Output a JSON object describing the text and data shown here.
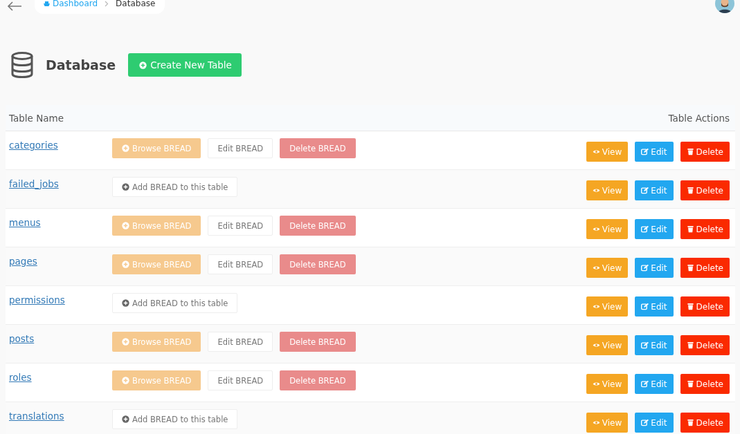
{
  "breadcrumb": [
    {
      "label": "Dashboard",
      "kind": "link"
    },
    {
      "label": "Database",
      "kind": "current"
    }
  ],
  "page_title": "Database",
  "create_button": "Create New Table",
  "table": {
    "columns": [
      "Table Name",
      "Table Actions"
    ],
    "rows": [
      {
        "name": "categories",
        "kind": "bread",
        "bread_actions": [
          "Browse BREAD",
          "Edit BREAD",
          "Delete BREAD"
        ],
        "actions": [
          "View",
          "Edit",
          "Delete"
        ]
      },
      {
        "name": "failed_jobs",
        "kind": "no-bread",
        "bread_actions": [
          "Add BREAD to this table"
        ],
        "actions": [
          "View",
          "Edit",
          "Delete"
        ]
      },
      {
        "name": "menus",
        "kind": "bread",
        "bread_actions": [
          "Browse BREAD",
          "Edit BREAD",
          "Delete BREAD"
        ],
        "actions": [
          "View",
          "Edit",
          "Delete"
        ]
      },
      {
        "name": "pages",
        "kind": "bread",
        "bread_actions": [
          "Browse BREAD",
          "Edit BREAD",
          "Delete BREAD"
        ],
        "actions": [
          "View",
          "Edit",
          "Delete"
        ]
      },
      {
        "name": "permissions",
        "kind": "no-bread",
        "bread_actions": [
          "Add BREAD to this table"
        ],
        "actions": [
          "View",
          "Edit",
          "Delete"
        ]
      },
      {
        "name": "posts",
        "kind": "bread",
        "bread_actions": [
          "Browse BREAD",
          "Edit BREAD",
          "Delete BREAD"
        ],
        "actions": [
          "View",
          "Edit",
          "Delete"
        ]
      },
      {
        "name": "roles",
        "kind": "bread",
        "bread_actions": [
          "Browse BREAD",
          "Edit BREAD",
          "Delete BREAD"
        ],
        "actions": [
          "View",
          "Edit",
          "Delete"
        ]
      },
      {
        "name": "translations",
        "kind": "no-bread",
        "bread_actions": [
          "Add BREAD to this table"
        ],
        "actions": [
          "View",
          "Edit",
          "Delete"
        ]
      }
    ]
  }
}
